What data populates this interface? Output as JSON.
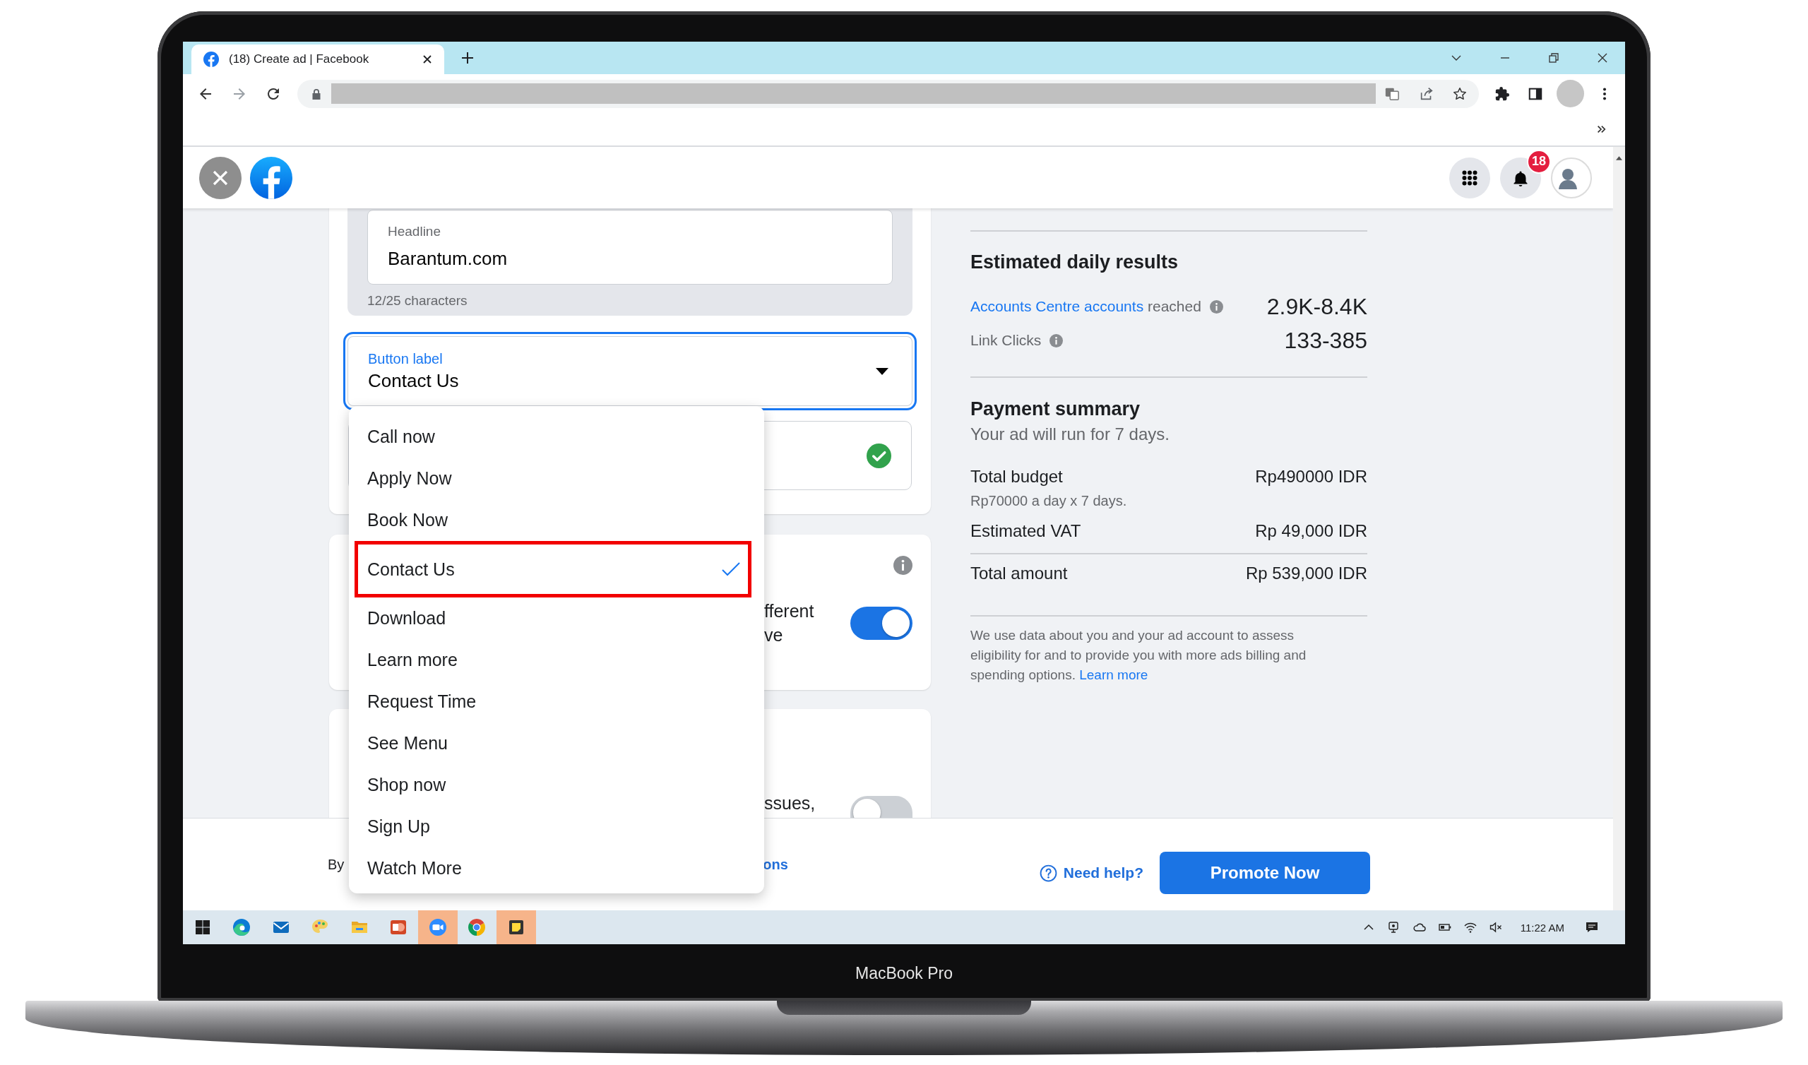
{
  "device": {
    "label": "MacBook Pro"
  },
  "browser": {
    "tab_title": "(18) Create ad | Facebook"
  },
  "page_header": {
    "notification_count": "18"
  },
  "ad_form": {
    "headline": {
      "label": "Headline",
      "value": "Barantum.com",
      "counter": "12/25 characters"
    },
    "button_label": {
      "label": "Button label",
      "value": "Contact Us",
      "expanded": true,
      "options": [
        {
          "label": "Call now",
          "selected": false
        },
        {
          "label": "Apply Now",
          "selected": false
        },
        {
          "label": "Book Now",
          "selected": false
        },
        {
          "label": "Contact Us",
          "selected": true
        },
        {
          "label": "Download",
          "selected": false
        },
        {
          "label": "Learn more",
          "selected": false
        },
        {
          "label": "Request Time",
          "selected": false
        },
        {
          "label": "See Menu",
          "selected": false
        },
        {
          "label": "Shop now",
          "selected": false
        },
        {
          "label": "Sign Up",
          "selected": false
        },
        {
          "label": "Watch More",
          "selected": false
        }
      ]
    },
    "input_field": {
      "valid": true
    },
    "sections": [
      {
        "info_icon": true,
        "lines": [
          "fferent",
          "ve"
        ],
        "toggle_on": true
      },
      {
        "lines": [
          "ssues,"
        ],
        "toggle_on": false
      }
    ]
  },
  "summary": {
    "estimates": {
      "title": "Estimated daily results",
      "metrics": [
        {
          "link": "Accounts Centre accounts",
          "label": "reached",
          "value": "2.9K-8.4K"
        },
        {
          "label": "Link Clicks",
          "value": "133-385"
        }
      ]
    },
    "payment": {
      "title": "Payment summary",
      "subtitle": "Your ad will run for 7 days.",
      "lines": [
        {
          "kind": "item",
          "label": "Total budget",
          "note": "Rp70000 a day x 7 days.",
          "amount": "Rp490000 IDR"
        },
        {
          "kind": "item",
          "label": "Estimated VAT",
          "amount": "Rp 49,000 IDR"
        },
        {
          "kind": "total",
          "label": "Total amount",
          "amount": "Rp 539,000 IDR"
        }
      ]
    },
    "disclaimer": {
      "text": "We use data about you and your ad account to assess eligibility for and to provide you with more ads billing and spending options.",
      "link": "Learn more"
    }
  },
  "footer": {
    "text": "By",
    "link": "ons",
    "help_link": "Need help?",
    "promote_button": "Promote Now"
  },
  "taskbar": {
    "apps": [
      {
        "kind": "edge",
        "flashing": false
      },
      {
        "kind": "mail",
        "flashing": false
      },
      {
        "kind": "paint",
        "flashing": false
      },
      {
        "kind": "explorer",
        "flashing": false
      },
      {
        "kind": "powerpoint",
        "flashing": false
      },
      {
        "kind": "zoom",
        "flashing": true
      },
      {
        "kind": "chrome",
        "flashing": false
      },
      {
        "kind": "sticky_notes",
        "flashing": true
      }
    ],
    "clock": "11:22 AM"
  }
}
